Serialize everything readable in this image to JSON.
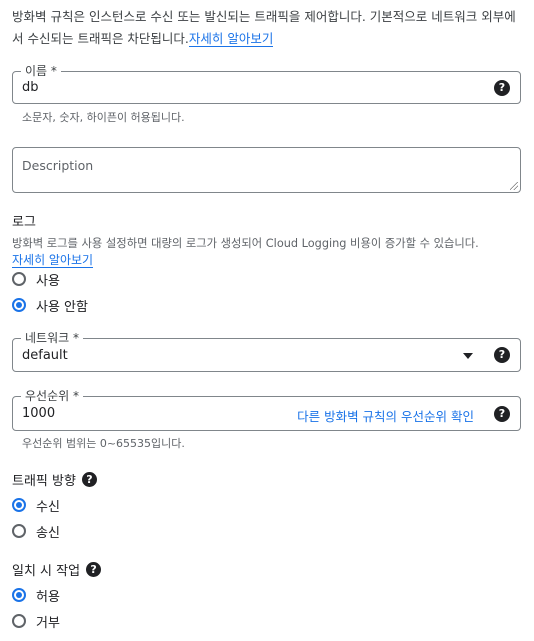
{
  "intro": {
    "text": "방화벽 규칙은 인스턴스로 수신 또는 발신되는 트래픽을 제어합니다. 기본적으로 네트워크 외부에서 수신되는 트래픽은 차단됩니다.",
    "learn_more": "자세히 알아보기"
  },
  "name_field": {
    "label": "이름 *",
    "value": "db",
    "hint": "소문자, 숫자, 하이픈이 허용됩니다.",
    "help_icon": "help-icon"
  },
  "description_field": {
    "placeholder": "Description"
  },
  "logs": {
    "title": "로그",
    "description": "방화벽 로그를 사용 설정하면 대량의 로그가 생성되어 Cloud Logging 비용이 증가할 수 있습니다.",
    "learn_more": "자세히 알아보기",
    "options": [
      {
        "label": "사용",
        "checked": false
      },
      {
        "label": "사용 안함",
        "checked": true
      }
    ]
  },
  "network_field": {
    "label": "네트워크 *",
    "value": "default"
  },
  "priority_field": {
    "label": "우선순위 *",
    "value": "1000",
    "link": "다른 방화벽 규칙의 우선순위 확인",
    "hint": "우선순위 범위는 0~65535입니다."
  },
  "traffic_direction": {
    "title": "트래픽 방향",
    "options": [
      {
        "label": "수신",
        "checked": true
      },
      {
        "label": "송신",
        "checked": false
      }
    ]
  },
  "action_on_match": {
    "title": "일치 시 작업",
    "options": [
      {
        "label": "허용",
        "checked": true
      },
      {
        "label": "거부",
        "checked": false
      }
    ]
  },
  "colors": {
    "accent": "#1a73e8",
    "text": "#202124",
    "muted": "#5f6368",
    "border": "#80868b"
  }
}
